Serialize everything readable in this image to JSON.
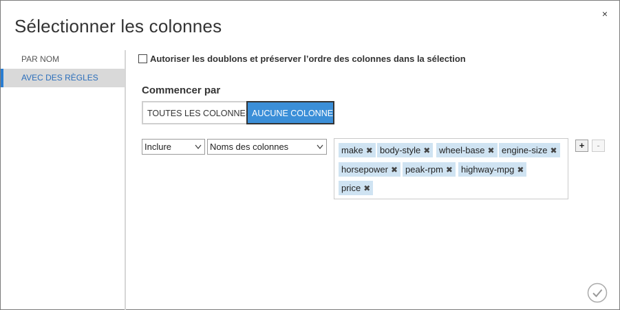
{
  "dialog": {
    "title": "Sélectionner les colonnes",
    "close_label": "×"
  },
  "sidebar": {
    "items": [
      {
        "label": "PAR NOM",
        "active": false
      },
      {
        "label": "AVEC DES RÈGLES",
        "active": true
      }
    ]
  },
  "options": {
    "allow_duplicates_label": "Autoriser les doublons et préserver l’ordre des colonnes dans la sélection",
    "allow_duplicates_checked": false
  },
  "start": {
    "title": "Commencer par",
    "all_columns_label": "TOUTES LES COLONNES",
    "no_columns_label": "AUCUNE COLONNE",
    "selected": "AUCUNE COLONNE"
  },
  "rule": {
    "mode_value": "Inclure",
    "type_value": "Noms des colonnes",
    "tags": [
      "make",
      "body-style",
      "wheel-base",
      "engine-size",
      "horsepower",
      "peak-rpm",
      "highway-mpg",
      "price"
    ],
    "add_label": "+",
    "remove_label": "-"
  },
  "colors": {
    "accent": "#3b8fd8",
    "tag_bg": "#cfe3f2",
    "sidebar_active_bg": "#d9d9d9",
    "sidebar_active_text": "#2a6ebb"
  },
  "icons": {
    "close": "close-icon",
    "confirm": "checkmark-circle-icon",
    "tag_remove": "x-icon",
    "dropdown": "chevron-down-icon"
  }
}
